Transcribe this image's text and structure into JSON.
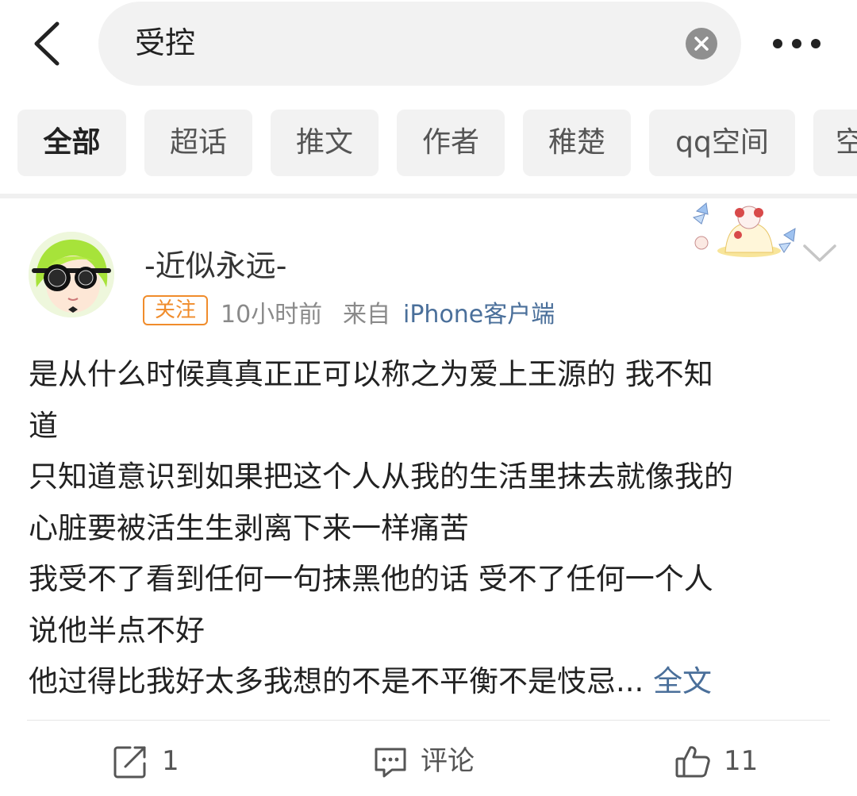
{
  "search": {
    "query": "受控"
  },
  "tabs": [
    "全部",
    "超话",
    "推文",
    "作者",
    "稚楚",
    "qq空间",
    "空"
  ],
  "post": {
    "username": "-近似永远-",
    "follow_label": "关注",
    "time": "10小时前",
    "from_label": "来自",
    "client": "iPhone客户端",
    "content_lines": [
      "是从什么时候真真正正可以称之为爱上王源的 我不知",
      "道",
      "只知道意识到如果把这个人从我的生活里抹去就像我的",
      "心脏要被活生生剥离下来一样痛苦",
      "我受不了看到任何一句抹黑他的话 受不了任何一个人",
      "说他半点不好",
      "他过得比我好太多我想的不是不平衡不是忮忌..."
    ],
    "fulltext_label": "全文"
  },
  "actions": {
    "repost_count": "1",
    "comment_label": "评论",
    "like_count": "11"
  },
  "colors": {
    "accent_orange": "#f08c2b",
    "link_blue": "#4a6f9a",
    "muted": "#8a8a8a"
  },
  "icons": [
    "back-arrow-icon",
    "clear-icon",
    "more-icon",
    "chevron-down-icon",
    "repost-icon",
    "comment-icon",
    "like-icon"
  ]
}
